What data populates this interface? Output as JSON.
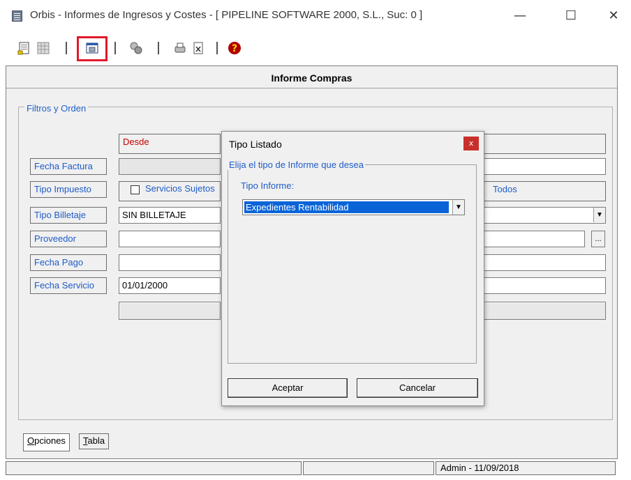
{
  "window": {
    "title": "Orbis - Informes de Ingresos y Costes - [ PIPELINE SOFTWARE 2000, S.L.,  Suc: 0 ]",
    "minimize": "—",
    "maximize": "☐",
    "close": "✕"
  },
  "toolbar": {
    "help_icon_glyph": "?"
  },
  "form": {
    "header": "Informe Compras",
    "group_title": "Filtros y Orden",
    "col_desde": "Desde",
    "rows": {
      "fecha_factura": "Fecha Factura",
      "tipo_impuesto": "Tipo Impuesto",
      "tipo_impuesto_check": "Servicios Sujetos",
      "tipo_impuesto_right": "Todos",
      "tipo_billetaje": "Tipo Billetaje",
      "tipo_billetaje_value": "SIN BILLETAJE",
      "proveedor": "Proveedor",
      "proveedor_ellipsis": "...",
      "fecha_pago": "Fecha Pago",
      "fecha_servicio": "Fecha Servicio",
      "fecha_servicio_value": "01/01/2000"
    }
  },
  "tabs": {
    "opciones_first": "O",
    "opciones_rest": "pciones",
    "tabla_first": "T",
    "tabla_rest": "abla"
  },
  "status": {
    "user_date": "Admin - 11/09/2018"
  },
  "dialog": {
    "title": "Tipo Listado",
    "close": "x",
    "group_title": "Elija el tipo de Informe que desea",
    "label": "Tipo Informe:",
    "selected": "Expedientes Rentabilidad",
    "accept": "Aceptar",
    "cancel": "Cancelar"
  },
  "colors": {
    "label_blue": "#1e5bc6",
    "desde_red": "#c00000",
    "highlight_red": "#e0192b",
    "selection_blue": "#0a64d8"
  }
}
